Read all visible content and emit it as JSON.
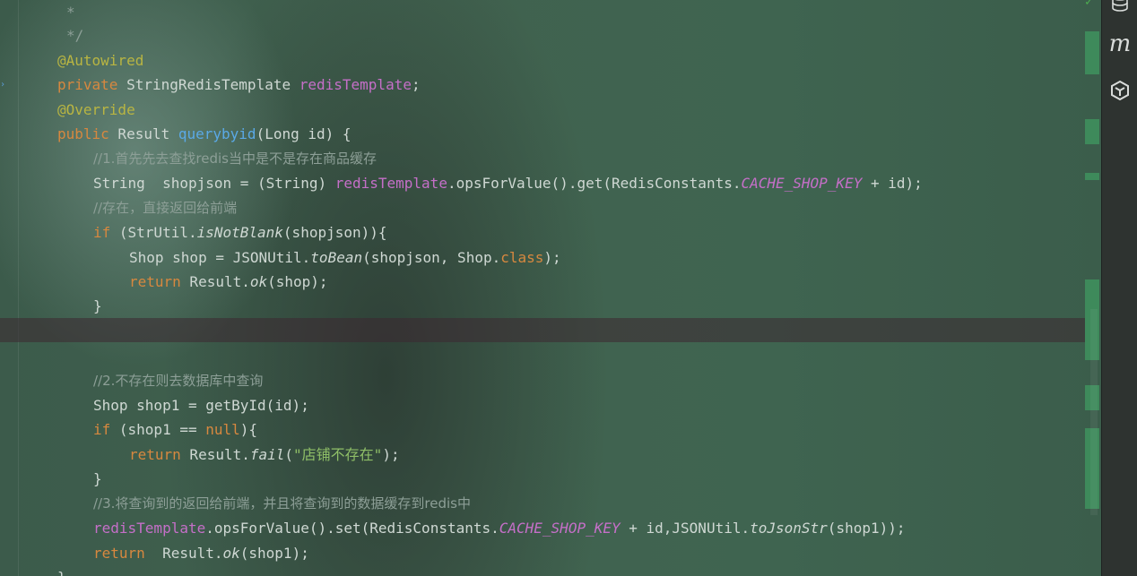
{
  "editor": {
    "lines": {
      "l1": "*",
      "l2": "*/",
      "l3": "@Autowired",
      "l4_kw": "private",
      "l4_type": " StringRedisTemplate ",
      "l4_field": "redisTemplate",
      "l4_end": ";",
      "l5": "@Override",
      "l6_kw": "public",
      "l6_type": " Result ",
      "l6_method": "querybyid",
      "l6_params": "(Long id) {",
      "l7": "//1.首先先去查找redis当中是不是存在商品缓存",
      "l8_a": "String  shopjson = (String) ",
      "l8_field": "redisTemplate",
      "l8_b": ".opsForValue().get(RedisConstants.",
      "l8_const": "CACHE_SHOP_KEY",
      "l8_c": " + id);",
      "l9": "//存在，直接返回给前端",
      "l10_kw": "if",
      "l10_a": " (StrUtil.",
      "l10_static": "isNotBlank",
      "l10_b": "(shopjson)){",
      "l11_a": "Shop shop = JSONUtil.",
      "l11_static": "toBean",
      "l11_b": "(shopjson, Shop.",
      "l11_kw": "class",
      "l11_c": ");",
      "l12_kw": "return",
      "l12_a": " Result.",
      "l12_static": "ok",
      "l12_b": "(shop);",
      "l13": "}",
      "l14": "//2.不存在则去数据库中查询",
      "l15": "Shop shop1 = getById(id);",
      "l16_kw": "if",
      "l16_a": " (shop1 == ",
      "l16_null": "null",
      "l16_b": "){",
      "l17_kw": "return",
      "l17_a": " Result.",
      "l17_static": "fail",
      "l17_b": "(",
      "l17_str": "\"店铺不存在\"",
      "l17_c": ");",
      "l18": "}",
      "l19": "//3.将查询到的返回给前端，并且将查询到的数据缓存到redis中",
      "l20_field": "redisTemplate",
      "l20_a": ".opsForValue().set(RedisConstants.",
      "l20_const": "CACHE_SHOP_KEY",
      "l20_b": " + id,JSONUtil.",
      "l20_static": "toJsonStr",
      "l20_c": "(shop1));",
      "l21_kw": "return",
      "l21_a": "  Result.",
      "l21_static": "ok",
      "l21_b": "(shop1);",
      "l22": "}"
    }
  },
  "toolbar": {
    "icons": [
      "database-icon",
      "maven-icon",
      "ai-assistant-icon"
    ],
    "maven_label": "m"
  },
  "colors": {
    "keyword": "#d7883f",
    "annotation": "#b9b542",
    "field": "#c56fc8",
    "method": "#5aa9e6",
    "comment": "#8d9f97",
    "string": "#8fbf67",
    "change_marker": "#3e8a5b"
  }
}
